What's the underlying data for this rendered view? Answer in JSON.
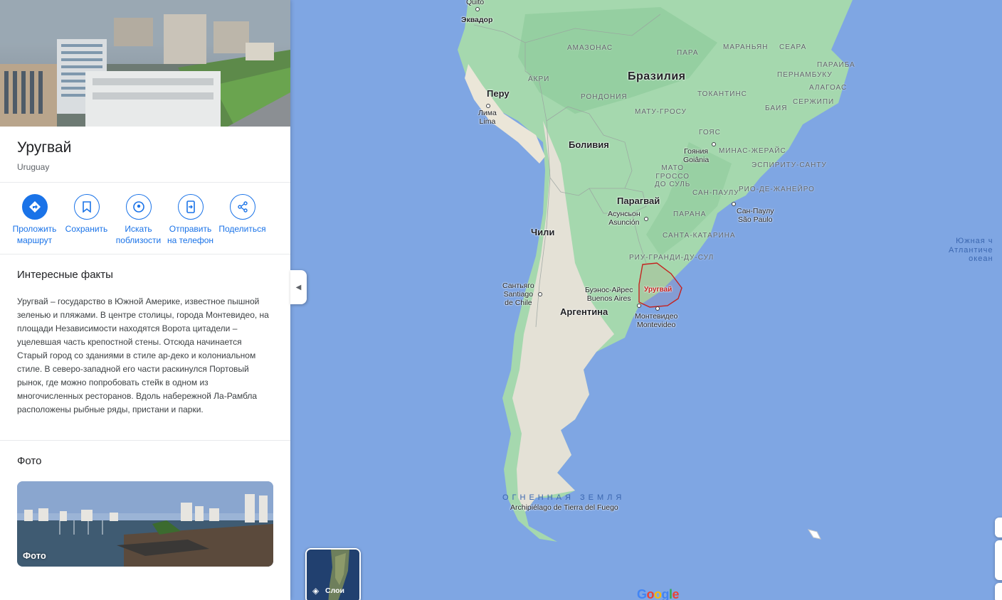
{
  "place": {
    "title": "Уругвай",
    "subtitle": "Uruguay"
  },
  "actions": [
    {
      "label": "Проложить маршрут",
      "icon": "directions-icon"
    },
    {
      "label": "Сохранить",
      "icon": "bookmark-icon"
    },
    {
      "label": "Искать поблизости",
      "icon": "nearby-icon"
    },
    {
      "label": "Отправить на телефон",
      "icon": "send-to-phone-icon"
    },
    {
      "label": "Поделиться",
      "icon": "share-icon"
    }
  ],
  "facts": {
    "title": "Интересные факты",
    "text": "Уругвай – государство в Южной Америке, известное пышной зеленью и пляжами. В центре столицы, города Монтевидео, на площади Независимости находятся Ворота цитадели – уцелевшая часть крепостной стены. Отсюда начинается Старый город со зданиями в стиле ар-деко и колониальном стиле. В северо-западной его части раскинулся Портовый рынок, где можно попробовать стейк в одном из многочисленных ресторанов. Вдоль набережной Ла-Рамбла расположены рыбные ряды, пристани и парки."
  },
  "photos": {
    "title": "Фото",
    "card_caption": "Фото"
  },
  "map": {
    "countries": {
      "brazil": "Бразилия",
      "peru": "Перу",
      "bolivia": "Боливия",
      "paraguay": "Парагвай",
      "chile": "Чили",
      "argentina": "Аргентина",
      "ecuador": "Эквадор",
      "uruguay": "Уругвай"
    },
    "regions": {
      "amazonas": "АМАЗОНАС",
      "para": "ПАРА",
      "maranhao": "МАРАНЬЯН",
      "ceara": "СЕАРА",
      "paraiba": "ПАРАИБА",
      "pernambuco": "ПЕРНАМБУКУ",
      "alagoas": "АЛАГОАС",
      "sergipe": "СЕРЖИПИ",
      "bahia": "БАИЯ",
      "acre": "АКРИ",
      "rondonia": "РОНДОНИЯ",
      "mato_grosso": "МАТУ-ГРОСУ",
      "tocantins": "ТОКАНТИНС",
      "goias": "ГОЯС",
      "minas": "МИНАС-ЖЕРАЙС",
      "espirito": "ЭСПИРИТУ-САНТУ",
      "mato_sul_1": "МАТО",
      "mato_sul_2": "ГРОССО",
      "mato_sul_3": "ДО СУЛЬ",
      "sao_paulo_state": "САН-ПАУЛУ",
      "rio": "РИО-ДЕ-ЖАНЕЙРО",
      "parana": "ПАРАНА",
      "santa_catarina": "САНТА-КАТАРИНА",
      "rio_grande": "РИУ-ГРАНДИ-ДУ-СУЛ"
    },
    "cities": {
      "quito": "Quito",
      "lima_ru": "Лима",
      "lima_en": "Lima",
      "goiania_ru": "Гояния",
      "goiania_en": "Goiânia",
      "asuncion_ru": "Асунсьон",
      "asuncion_en": "Asunción",
      "sao_paulo_ru": "Сан-Паулу",
      "sao_paulo_en": "São Paulo",
      "santiago_ru": "Сантьяго",
      "santiago_en": "Santiago",
      "santiago_en2": "de Chile",
      "buenos_ru": "Буэнос-Айрес",
      "buenos_en": "Buenos Aires",
      "montevideo_ru": "Монтевидео",
      "montevideo_en": "Montevideo"
    },
    "ocean_1": "Южная ч",
    "ocean_2": "Атлантиче",
    "ocean_3": "океан",
    "fire_ru": "ОГНЕННАЯ ЗЕМЛЯ",
    "fire_es": "Archipiélago de Tierra del Fuego",
    "layers_label": "Слои"
  },
  "colors": {
    "accent": "#1a73e8",
    "selected_border": "#c5221f",
    "water": "#7fa6e3",
    "land_green": "#8ccf9c",
    "land_arid": "#e6e3d8"
  }
}
